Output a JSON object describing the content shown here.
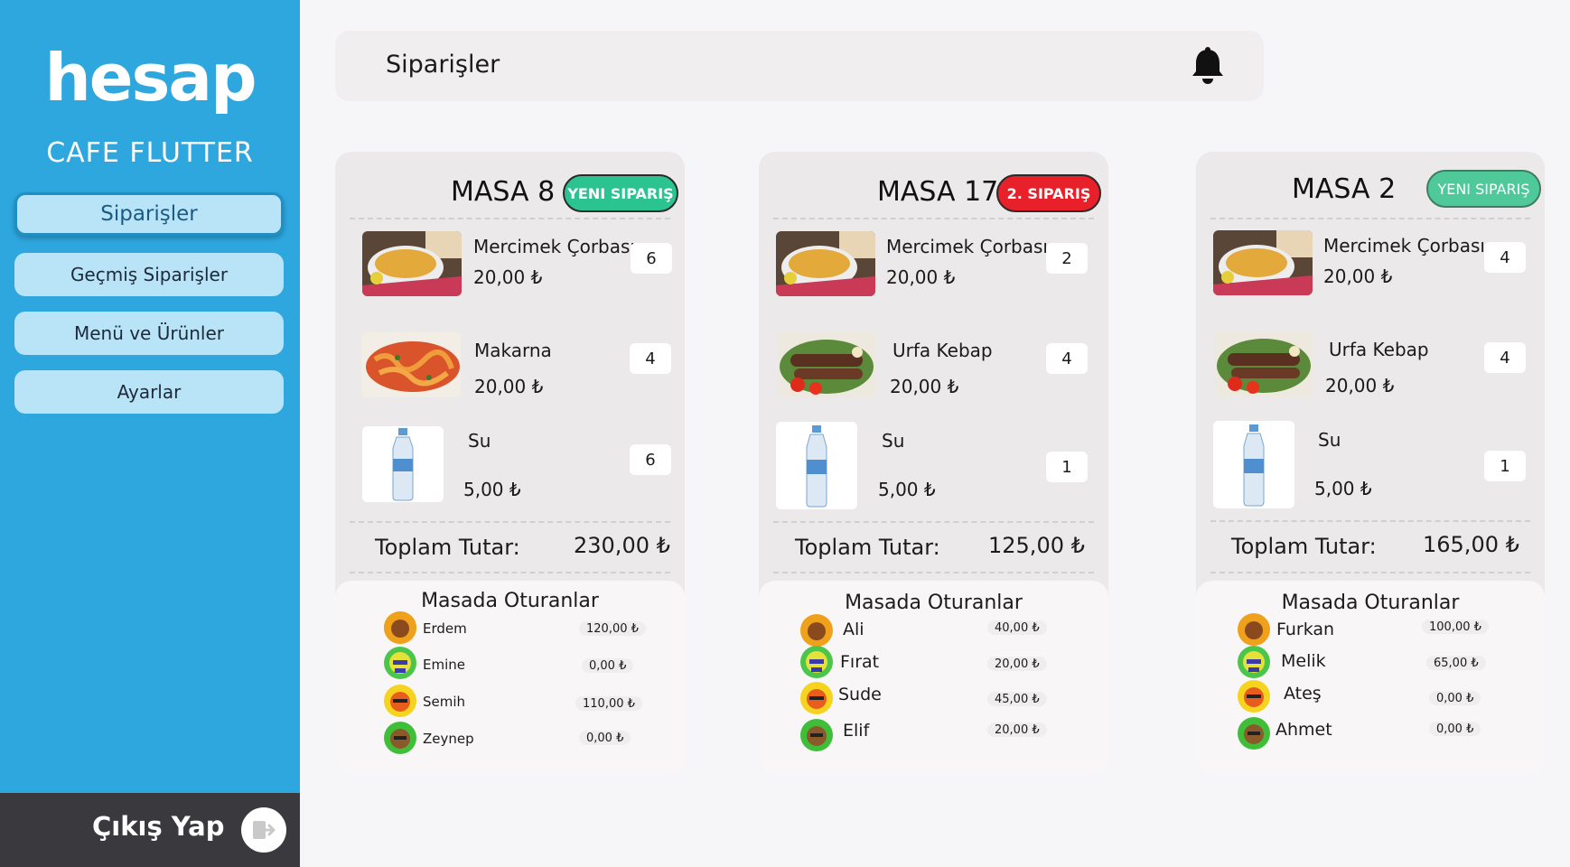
{
  "sidebar": {
    "logo": "hesap",
    "cafe_name": "CAFE FLUTTER",
    "nav": [
      {
        "label": "Siparişler"
      },
      {
        "label": "Geçmiş Siparişler"
      },
      {
        "label": "Menü ve Ürünler"
      },
      {
        "label": "Ayarlar"
      }
    ],
    "logout_label": "Çıkış Yap"
  },
  "header": {
    "title": "Siparişler",
    "icon": "bell-icon"
  },
  "colors": {
    "sidebar": "#2ea7df",
    "badge_new": "#2bc38f",
    "badge_second": "#e8202a",
    "logout_bg": "#3a3a3e"
  },
  "tables": [
    {
      "title": "MASA 8",
      "badge": "YENI SIPARIŞ",
      "items": [
        {
          "name": "Mercimek Çorbası",
          "price": "20,00 ₺",
          "qty": "6",
          "img": "soup"
        },
        {
          "name": "Makarna",
          "price": "20,00 ₺",
          "qty": "4",
          "img": "pasta"
        },
        {
          "name": "Su",
          "price": "5,00 ₺",
          "qty": "6",
          "img": "water"
        }
      ],
      "total_label": "Toplam Tutar:",
      "total": "230,00 ₺",
      "diners_title": "Masada Oturanlar",
      "diners": [
        {
          "name": "Erdem",
          "amount": "120,00 ₺"
        },
        {
          "name": "Emine",
          "amount": "0,00 ₺"
        },
        {
          "name": "Semih",
          "amount": "110,00 ₺"
        },
        {
          "name": "Zeynep",
          "amount": "0,00 ₺"
        }
      ]
    },
    {
      "title": "MASA 17",
      "badge": "2. SIPARIŞ",
      "items": [
        {
          "name": "Mercimek Çorbası",
          "price": "20,00 ₺",
          "qty": "2",
          "img": "soup"
        },
        {
          "name": "Urfa Kebap",
          "price": "20,00 ₺",
          "qty": "4",
          "img": "kebab"
        },
        {
          "name": "Su",
          "price": "5,00 ₺",
          "qty": "1",
          "img": "water"
        }
      ],
      "total_label": "Toplam Tutar:",
      "total": "125,00 ₺",
      "diners_title": "Masada Oturanlar",
      "diners": [
        {
          "name": "Ali",
          "amount": "40,00 ₺"
        },
        {
          "name": "Fırat",
          "amount": "20,00 ₺"
        },
        {
          "name": "Sude",
          "amount": "45,00 ₺"
        },
        {
          "name": "Elif",
          "amount": "20,00 ₺"
        }
      ]
    },
    {
      "title": "MASA 2",
      "badge": "YENI SIPARIŞ",
      "items": [
        {
          "name": "Mercimek Çorbası",
          "price": "20,00 ₺",
          "qty": "4",
          "img": "soup"
        },
        {
          "name": "Urfa Kebap",
          "price": "20,00 ₺",
          "qty": "4",
          "img": "kebab"
        },
        {
          "name": "Su",
          "price": "5,00 ₺",
          "qty": "1",
          "img": "water"
        }
      ],
      "total_label": "Toplam Tutar:",
      "total": "165,00 ₺",
      "diners_title": "Masada Oturanlar",
      "diners": [
        {
          "name": "Furkan",
          "amount": "100,00 ₺"
        },
        {
          "name": "Melik",
          "amount": "65,00 ₺"
        },
        {
          "name": "Ateş",
          "amount": "0,00 ₺"
        },
        {
          "name": "Ahmet",
          "amount": "0,00 ₺"
        }
      ]
    }
  ]
}
